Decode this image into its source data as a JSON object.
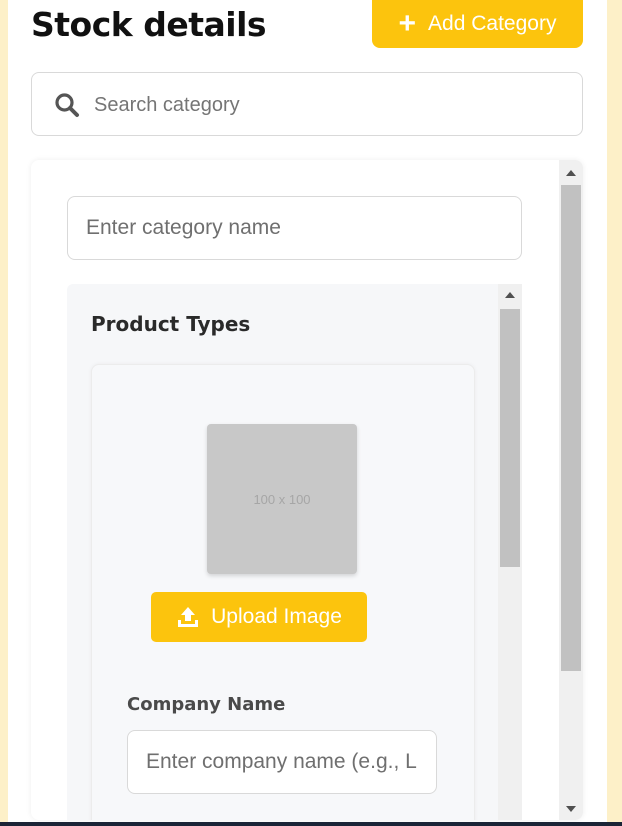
{
  "header": {
    "title": "Stock details",
    "add_button_label": "Add Category"
  },
  "search": {
    "placeholder": "Search category",
    "value": ""
  },
  "category_form": {
    "name_placeholder": "Enter category name",
    "product_types": {
      "title": "Product Types",
      "image_placeholder_text": "100 x 100",
      "upload_button_label": "Upload Image",
      "company_name_label": "Company Name",
      "company_name_placeholder": "Enter company name (e.g., L"
    }
  },
  "colors": {
    "accent": "#fcc40d",
    "page_background": "#fdf0c8",
    "section_background": "#f6f7f9"
  },
  "icons": {
    "add": "plus-icon",
    "search": "search-icon",
    "upload": "upload-icon"
  }
}
